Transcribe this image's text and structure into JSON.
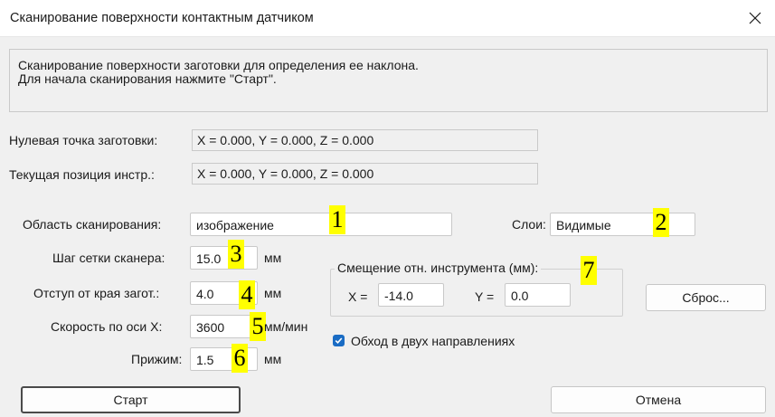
{
  "dialog": {
    "title": "Сканирование поверхности контактным датчиком"
  },
  "description": {
    "line1": "Сканирование поверхности заготовки для определения ее наклона.",
    "line2": "Для начала сканирования нажмите \"Старт\"."
  },
  "zero_point": {
    "label": "Нулевая точка заготовки:",
    "value": "X = 0.000, Y = 0.000, Z = 0.000"
  },
  "current_pos": {
    "label": "Текущая позиция инстр.:",
    "value": "X = 0.000, Y = 0.000, Z = 0.000"
  },
  "scan_area": {
    "label": "Область сканирования:",
    "value": "изображение"
  },
  "layers": {
    "label": "Слои:",
    "value": "Видимые"
  },
  "grid_step": {
    "label": "Шаг сетки сканера:",
    "value": "15.0",
    "unit": "мм"
  },
  "edge_offset": {
    "label": "Отступ от края загот.:",
    "value": "4.0",
    "unit": "мм"
  },
  "x_speed": {
    "label": "Скорость по оси X:",
    "value": "3600",
    "unit": "мм/мин"
  },
  "pressure": {
    "label": "Прижим:",
    "value": "1.5",
    "unit": "мм"
  },
  "tool_offset": {
    "group_label": "Смещение отн. инструмента (мм):",
    "x_label": "X =",
    "x_value": "-14.0",
    "y_label": "Y =",
    "y_value": "0.0"
  },
  "reset_button": "Сброс...",
  "bidirectional": {
    "label": "Обход в двух направлениях",
    "checked": true
  },
  "start_button": "Старт",
  "cancel_button": "Отмена",
  "markers": [
    "1",
    "2",
    "3",
    "4",
    "5",
    "6",
    "7"
  ],
  "colors": {
    "marker": "#ffff00",
    "checkbox": "#1a6cc4"
  }
}
